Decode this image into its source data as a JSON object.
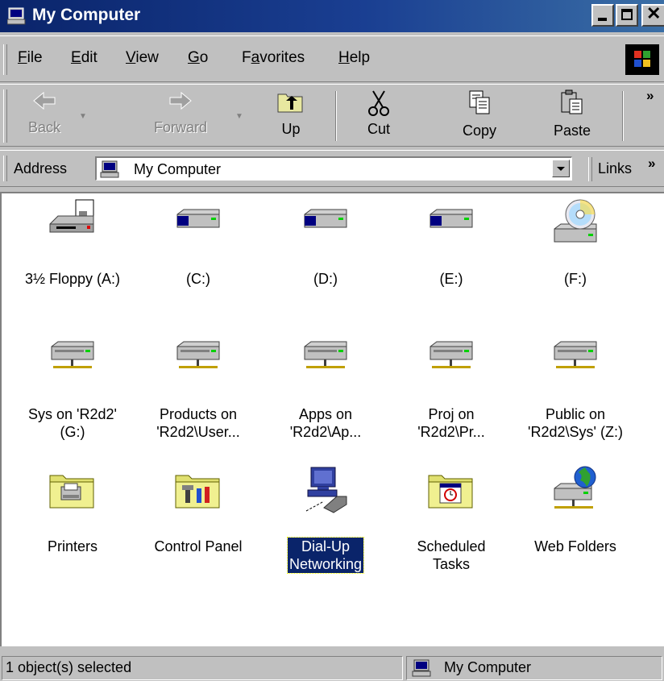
{
  "window": {
    "title": "My Computer",
    "icon": "my-computer-icon",
    "controls": [
      "minimize",
      "maximize",
      "close"
    ]
  },
  "menu": {
    "items": [
      {
        "label": "File",
        "mnemonic": "F"
      },
      {
        "label": "Edit",
        "mnemonic": "E"
      },
      {
        "label": "View",
        "mnemonic": "V"
      },
      {
        "label": "Go",
        "mnemonic": "G"
      },
      {
        "label": "Favorites",
        "mnemonic": "a"
      },
      {
        "label": "Help",
        "mnemonic": "H"
      }
    ]
  },
  "toolbar": {
    "back": {
      "label": "Back",
      "icon": "back-arrow-icon",
      "enabled": false
    },
    "forward": {
      "label": "Forward",
      "icon": "forward-arrow-icon",
      "enabled": false
    },
    "up": {
      "label": "Up",
      "icon": "up-folder-icon",
      "enabled": true
    },
    "cut": {
      "label": "Cut",
      "icon": "scissors-icon",
      "enabled": true
    },
    "copy": {
      "label": "Copy",
      "icon": "copy-icon",
      "enabled": true
    },
    "paste": {
      "label": "Paste",
      "icon": "paste-icon",
      "enabled": true
    },
    "more": "»"
  },
  "address": {
    "label": "Address",
    "value": "My Computer",
    "links_label": "Links",
    "links_more": "»"
  },
  "items": [
    {
      "label": "3½ Floppy (A:)",
      "icon": "floppy-drive-icon",
      "selected": false
    },
    {
      "label": "(C:)",
      "icon": "hard-drive-icon",
      "selected": false
    },
    {
      "label": "(D:)",
      "icon": "hard-drive-icon",
      "selected": false
    },
    {
      "label": "(E:)",
      "icon": "hard-drive-icon",
      "selected": false
    },
    {
      "label": "(F:)",
      "icon": "cd-drive-icon",
      "selected": false
    },
    {
      "label": "Sys on 'R2d2'\n(G:)",
      "icon": "network-drive-icon",
      "selected": false
    },
    {
      "label": "Products on\n'R2d2\\User...",
      "icon": "network-drive-icon",
      "selected": false
    },
    {
      "label": "Apps on\n'R2d2\\Ap...",
      "icon": "network-drive-icon",
      "selected": false
    },
    {
      "label": "Proj on\n'R2d2\\Pr...",
      "icon": "network-drive-icon",
      "selected": false
    },
    {
      "label": "Public on\n'R2d2\\Sys' (Z:)",
      "icon": "network-drive-icon",
      "selected": false
    },
    {
      "label": "Printers",
      "icon": "printers-folder-icon",
      "selected": false
    },
    {
      "label": "Control Panel",
      "icon": "control-panel-icon",
      "selected": false
    },
    {
      "label": "Dial-Up\nNetworking",
      "icon": "dialup-networking-icon",
      "selected": true
    },
    {
      "label": "Scheduled\nTasks",
      "icon": "scheduled-tasks-icon",
      "selected": false
    },
    {
      "label": "Web Folders",
      "icon": "web-folders-icon",
      "selected": false
    }
  ],
  "status": {
    "left": "1 object(s) selected",
    "right": "My Computer"
  },
  "colors": {
    "titlebar": "#0a246a",
    "face": "#c0c0c0",
    "selection": "#0a246a"
  }
}
